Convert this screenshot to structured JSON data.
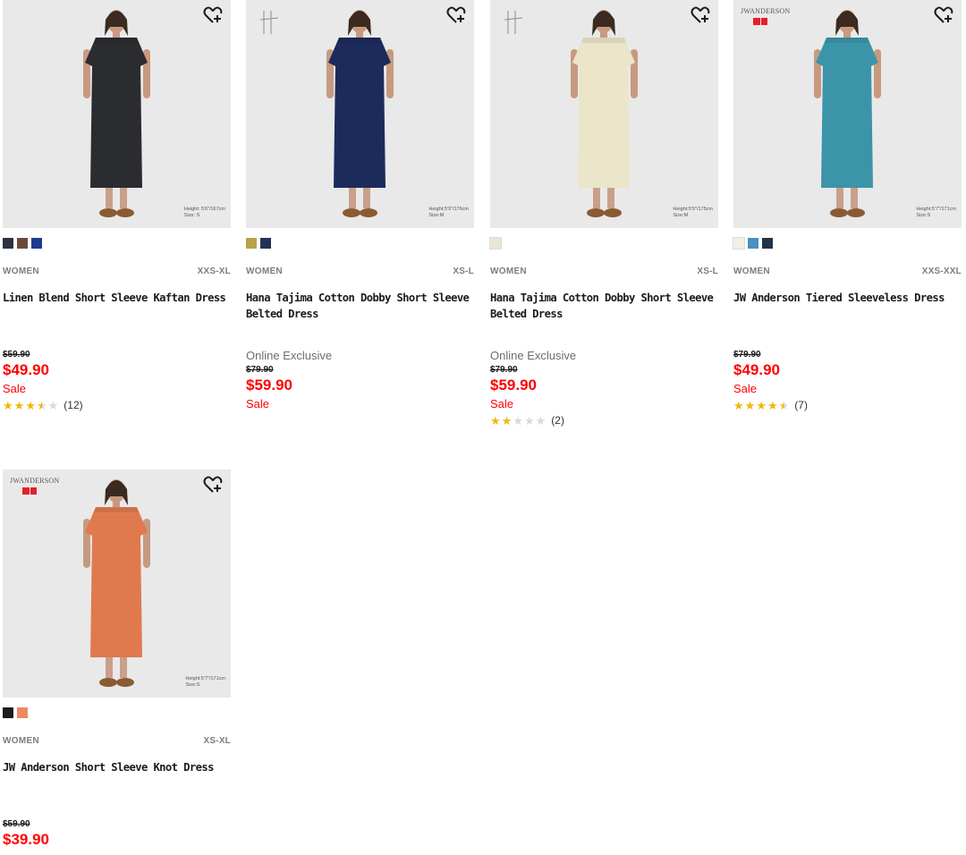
{
  "products": [
    {
      "name": "Linen Blend Short Sleeve Kaftan Dress",
      "gender": "WOMEN",
      "size_range": "XXS-XL",
      "exclusive": "",
      "original_price": "$59.90",
      "sale_price": "$49.90",
      "sale_label": "Sale",
      "rating_value": 3.5,
      "rating_count": "(12)",
      "model_info": [
        "Height: 5'6\"/167cm",
        "Size: S"
      ],
      "logo": "",
      "swatches": [
        "#2e3140",
        "#6b4a3a",
        "#1f3b8f"
      ],
      "dress_color": "#2b2c30"
    },
    {
      "name": "Hana Tajima Cotton Dobby Short Sleeve Belted Dress",
      "gender": "WOMEN",
      "size_range": "XS-L",
      "exclusive": "Online Exclusive",
      "original_price": "$79.90",
      "sale_price": "$59.90",
      "sale_label": "Sale",
      "rating_value": null,
      "rating_count": "",
      "model_info": [
        "Height:5'9\"/176cm",
        "Size:M"
      ],
      "logo": "hana",
      "swatches": [
        "#b8a24a",
        "#243055"
      ],
      "dress_color": "#1d2b5c"
    },
    {
      "name": "Hana Tajima Cotton Dobby Short Sleeve Belted Dress",
      "gender": "WOMEN",
      "size_range": "XS-L",
      "exclusive": "Online Exclusive",
      "original_price": "$79.90",
      "sale_price": "$59.90",
      "sale_label": "Sale",
      "rating_value": 2,
      "rating_count": "(2)",
      "model_info": [
        "Height:5'9\"/175cm",
        "Size:M"
      ],
      "logo": "hana",
      "swatches": [
        "#ebe6cf"
      ],
      "dress_color": "#ebe5c9"
    },
    {
      "name": "JW Anderson Tiered Sleeveless Dress",
      "gender": "WOMEN",
      "size_range": "XXS-XXL",
      "exclusive": "",
      "original_price": "$79.90",
      "sale_price": "$49.90",
      "sale_label": "Sale",
      "rating_value": 4.5,
      "rating_count": "(7)",
      "model_info": [
        "Height:5'7\"/171cm",
        "Size:S"
      ],
      "logo": "jw",
      "logo_text": "JWANDERSON",
      "swatches": [
        "#f3efe2",
        "#4a8fbd",
        "#213349"
      ],
      "dress_color": "#3b94a8"
    },
    {
      "name": "JW Anderson Short Sleeve Knot Dress",
      "gender": "WOMEN",
      "size_range": "XS-XL",
      "exclusive": "",
      "original_price": "$59.90",
      "sale_price": "$39.90",
      "sale_label": "",
      "rating_value": null,
      "rating_count": "",
      "model_info": [
        "Height:5'7\"/171cm",
        "Size:S"
      ],
      "logo": "jw",
      "logo_text": "JWANDERSON",
      "swatches": [
        "#1c1c1c",
        "#ea8a63"
      ],
      "dress_color": "#e07a4e"
    }
  ]
}
